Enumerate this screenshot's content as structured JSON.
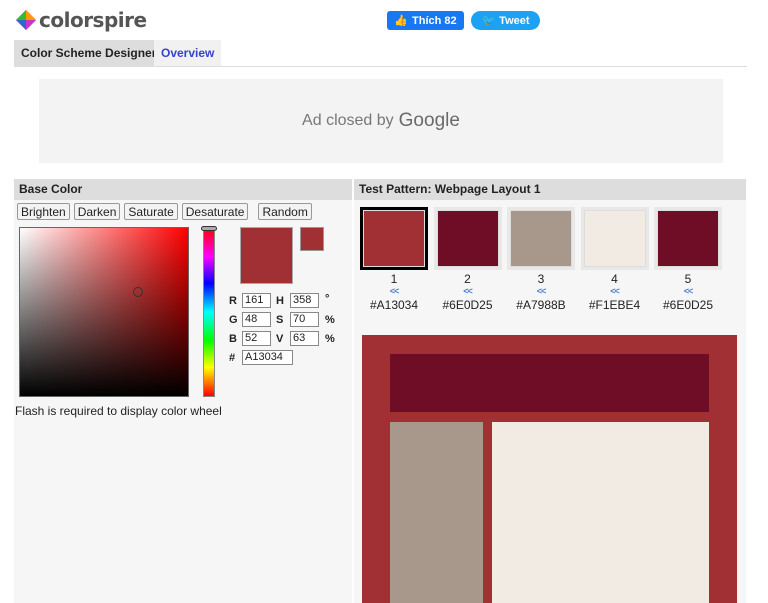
{
  "brand": {
    "name": "colorspire"
  },
  "social": {
    "like_label": "Thích 82",
    "tweet_label": "Tweet"
  },
  "tabs": [
    {
      "label": "Color Scheme Designer",
      "active": true
    },
    {
      "label": "Overview",
      "active": false
    }
  ],
  "ad": {
    "text": "Ad closed by",
    "brand": "Google"
  },
  "base": {
    "title": "Base Color",
    "buttons": [
      "Brighten",
      "Darken",
      "Saturate",
      "Desaturate",
      "Random"
    ],
    "r": "161",
    "g": "48",
    "b": "52",
    "h": "358",
    "s": "70",
    "v": "63",
    "hex": "A13034",
    "labels": {
      "r": "R",
      "g": "G",
      "b": "B",
      "h": "H",
      "s": "S",
      "v": "V",
      "hash": "#",
      "deg": "°",
      "pct": "%"
    },
    "flash": "Flash is required to display color wheel",
    "color": "#A13034"
  },
  "pattern": {
    "title": "Test Pattern: Webpage Layout 1",
    "arrow": "<<",
    "swatches": [
      {
        "n": "1",
        "hex": "#A13034"
      },
      {
        "n": "2",
        "hex": "#6E0D25"
      },
      {
        "n": "3",
        "hex": "#A7988B"
      },
      {
        "n": "4",
        "hex": "#F1EBE4"
      },
      {
        "n": "5",
        "hex": "#6E0D25"
      }
    ]
  }
}
